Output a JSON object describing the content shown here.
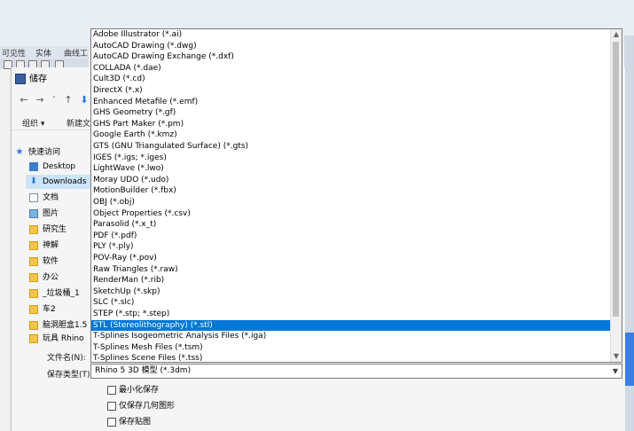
{
  "background_app": {
    "menu": [
      "可见性",
      "实体",
      "曲线工具"
    ],
    "highlight_color": "#3c7de0"
  },
  "dialog": {
    "title": "储存",
    "commands": {
      "organize": "组织 ▾",
      "new_folder": "新建文"
    },
    "sidebar": [
      {
        "label": "快速访问",
        "icon": "star-icon",
        "selected": false
      },
      {
        "label": "Desktop",
        "icon": "desktop-icon",
        "selected": false
      },
      {
        "label": "Downloads",
        "icon": "download-icon",
        "selected": true
      },
      {
        "label": "文档",
        "icon": "document-icon",
        "selected": false
      },
      {
        "label": "图片",
        "icon": "picture-icon",
        "selected": false
      },
      {
        "label": "研究生",
        "icon": "folder-icon",
        "selected": false
      },
      {
        "label": "神解",
        "icon": "folder-icon",
        "selected": false
      },
      {
        "label": "软件",
        "icon": "folder-icon",
        "selected": false
      },
      {
        "label": "办公",
        "icon": "folder-icon",
        "selected": false
      },
      {
        "label": "_垃圾桶_1",
        "icon": "folder-icon",
        "selected": false
      },
      {
        "label": "车2",
        "icon": "folder-icon",
        "selected": false
      },
      {
        "label": "脑洞胆盒1.5",
        "icon": "folder-icon",
        "selected": false
      },
      {
        "label": "玩具 Rhino",
        "icon": "folder-icon",
        "selected": false
      }
    ],
    "filename_label": "文件名(N):",
    "filetype_label": "保存类型(T):",
    "filetype_value": "Rhino 5 3D 模型 (*.3dm)",
    "file_types": [
      "Adobe Illustrator (*.ai)",
      "AutoCAD Drawing (*.dwg)",
      "AutoCAD Drawing Exchange (*.dxf)",
      "COLLADA (*.dae)",
      "Cult3D (*.cd)",
      "DirectX (*.x)",
      "Enhanced Metafile (*.emf)",
      "GHS Geometry (*.gf)",
      "GHS Part Maker (*.pm)",
      "Google Earth (*.kmz)",
      "GTS (GNU Triangulated Surface) (*.gts)",
      "IGES (*.igs; *.iges)",
      "LightWave (*.lwo)",
      "Moray UDO (*.udo)",
      "MotionBuilder (*.fbx)",
      "OBJ (*.obj)",
      "Object Properties (*.csv)",
      "Parasolid (*.x_t)",
      "PDF (*.pdf)",
      "PLY (*.ply)",
      "POV-Ray (*.pov)",
      "Raw Triangles (*.raw)",
      "RenderMan (*.rib)",
      "SketchUp (*.skp)",
      "SLC (*.slc)",
      "STEP (*.stp; *.step)",
      "STL (Stereolithography) (*.stl)",
      "T-Splines Isogeometric Analysis Files (*.iga)",
      "T-Splines Mesh Files (*.tsm)",
      "T-Splines Scene Files (*.tss)"
    ],
    "selected_index": 26,
    "selected_color": "#0078d7",
    "options": {
      "minimize": "最小化保存",
      "geometry_only": "仅保存几何图形",
      "save_texture": "保存贴图"
    }
  }
}
